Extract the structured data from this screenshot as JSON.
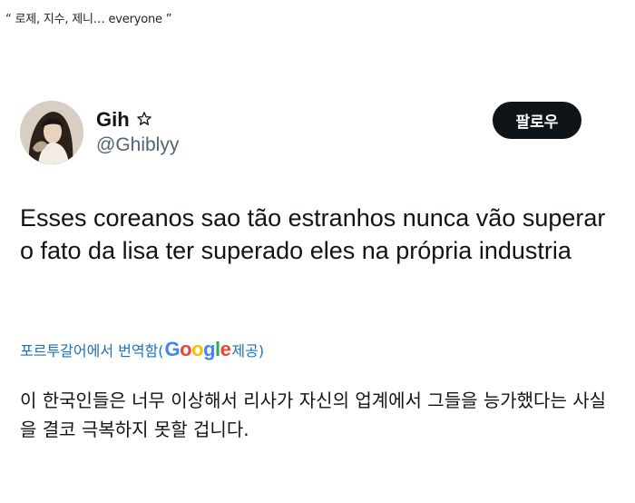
{
  "caption": "“ 로제, 지수, 제니… everyone ”",
  "profile": {
    "display_name": "Gih",
    "badge_icon": "star-outline-icon",
    "handle": "@Ghiblyy"
  },
  "follow_button_label": "팔로우",
  "tweet": {
    "text": "Esses coreanos sao tão estranhos nunca vão superar o fato da lisa ter superado eles na própria industria"
  },
  "translation": {
    "prefix": "포르투갈어에서 번역함(",
    "provider": "Google",
    "suffix": " 제공)",
    "text": "이 한국인들은 너무 이상해서 리사가 자신의 업계에서 그들을 능가했다는 사실을 결코 극복하지 못할 겁니다."
  },
  "colors": {
    "text": "#0f1419",
    "secondary": "#536471",
    "link": "#1d72b8",
    "button_bg": "#0f1419"
  }
}
